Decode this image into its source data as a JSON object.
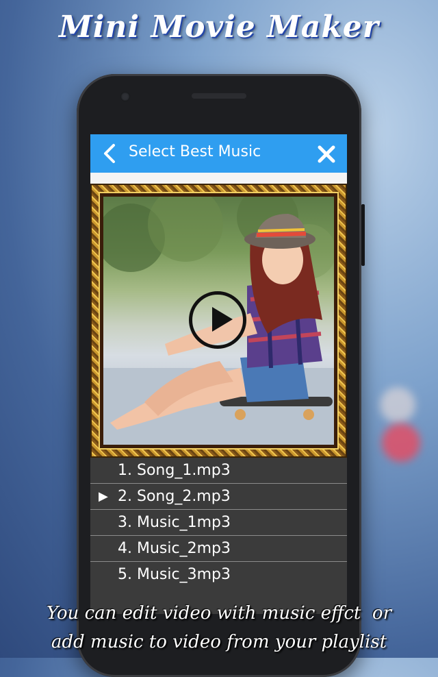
{
  "promo": {
    "title": "Mini Movie Maker",
    "caption_line1": "You can edit video with music effct  or",
    "caption_line2": "add music to video from your playlist"
  },
  "app": {
    "header_title": "Select Best Music",
    "back_icon": "chevron-left-icon",
    "close_icon": "close-icon",
    "accent_color": "#2f9ef0"
  },
  "preview": {
    "play_icon": "play-icon"
  },
  "playlist": {
    "selected_index": 1,
    "selected_marker": "▶",
    "items": [
      {
        "label": "1. Song_1.mp3"
      },
      {
        "label": "2. Song_2.mp3"
      },
      {
        "label": "3. Music_1mp3"
      },
      {
        "label": "4. Music_2mp3"
      },
      {
        "label": "5. Music_3mp3"
      }
    ]
  }
}
